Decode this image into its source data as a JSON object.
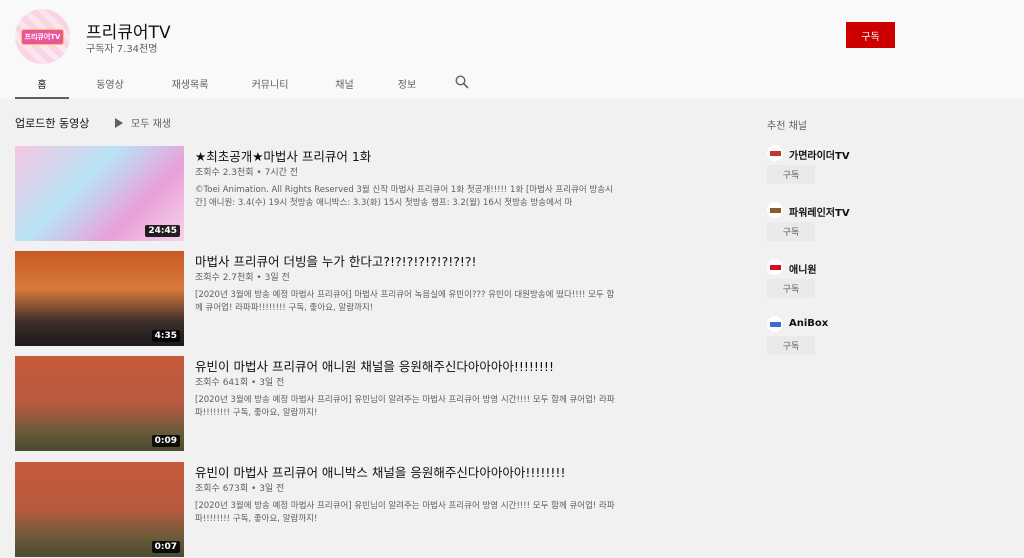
{
  "channel": {
    "name": "프리큐어TV",
    "subscribers": "구독자 7.34천명",
    "subscribe_label": "구독",
    "avatar_text": "프리큐어TV"
  },
  "tabs": [
    {
      "label": "홈"
    },
    {
      "label": "동영상"
    },
    {
      "label": "재생목록"
    },
    {
      "label": "커뮤니티"
    },
    {
      "label": "채널"
    },
    {
      "label": "정보"
    }
  ],
  "section": {
    "title": "업로드한 동영상",
    "play_all": "모두 재생"
  },
  "videos": [
    {
      "title": "★최초공개★마법사 프리큐어 1화",
      "meta": "조회수 2.3천회 • 7시간 전",
      "desc": "©Toei Animation. All Rights Reserved 3월 신작 마법사 프리큐어 1화 첫공개!!!!! 1화 [마법사 프리큐어 방송시간] 애니원: 3.4(수) 19시 첫방송 애니박스: 3.3(화) 15시 첫방송 챔프: 3.2(월) 16시 첫방송 방송에서 마",
      "duration": "24:45"
    },
    {
      "title": "마법사 프리큐어 더빙을 누가 한다고?!?!?!?!?!?!?!?!",
      "meta": "조회수 2.7천회 • 3일 전",
      "desc": "[2020년 3월에 방송 예정 마법사 프리큐어] 마법사 프리큐어 녹음실에 유빈이??? 유빈이 대원방송에 떴다!!!! 모두 함께 큐어업! 라파파!!!!!!!! 구독, 좋아요, 알람까지!",
      "duration": "4:35"
    },
    {
      "title": "유빈이 마법사 프리큐어 애니원 채널을 응원해주신다아아아아!!!!!!!!",
      "meta": "조회수 641회 • 3일 전",
      "desc": "[2020년 3월에 방송 예정 마법사 프리큐어] 유빈님이 알려주는 마법사 프리큐어 방영 시간!!!! 모두 함께 큐어업! 라파파!!!!!!!! 구독, 좋아요, 알람까지!",
      "duration": "0:09"
    },
    {
      "title": "유빈이 마법사 프리큐어 애니박스 채널을 응원해주신다아아아아!!!!!!!!",
      "meta": "조회수 673회 • 3일 전",
      "desc": "[2020년 3월에 방송 예정 마법사 프리큐어] 유빈님이 알려주는 마법사 프리큐어 방영 시간!!!! 모두 함께 큐어업! 라파파!!!!!!!! 구독, 좋아요, 알람까지!",
      "duration": "0:07"
    }
  ],
  "recommended": {
    "title": "추천 채널",
    "channels": [
      {
        "name": "가면라이더TV",
        "button": "구독",
        "color": "#c0392b"
      },
      {
        "name": "파워레인저TV",
        "button": "구독",
        "color": "#8e5a2b"
      },
      {
        "name": "애니원",
        "button": "구독",
        "color": "#d0102a"
      },
      {
        "name": "AniBox",
        "button": "구독",
        "color": "#3b6fd1"
      }
    ]
  },
  "colors": {
    "accent": "#cc0000"
  }
}
